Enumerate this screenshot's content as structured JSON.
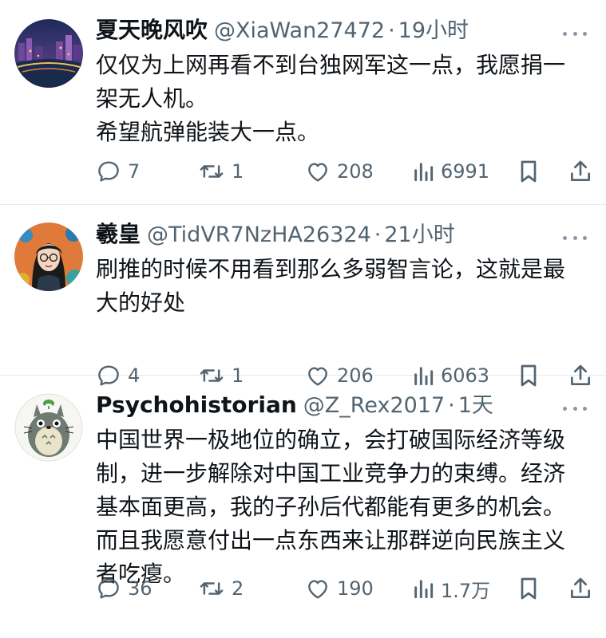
{
  "tweets": [
    {
      "display_name": "夏天晚风吹",
      "handle": "@XiaWan27472",
      "separator": "·",
      "time": "19小时",
      "lines": [
        "仅仅为上网再看不到台独网军这一点，我愿捐一",
        "架无人机。",
        "希望航弹能装大一点。"
      ],
      "replies": "7",
      "retweets": "1",
      "likes": "208",
      "views": "6991"
    },
    {
      "display_name": "羲皇",
      "handle": "@TidVR7NzHA26324",
      "separator": "·",
      "time": "21小时",
      "lines": [
        "刷推的时候不用看到那么多弱智言论，这就是最",
        "大的好处"
      ],
      "replies": "4",
      "retweets": "1",
      "likes": "206",
      "views": "6063"
    },
    {
      "display_name": "Psychohistorian",
      "handle": "@Z_Rex2017",
      "separator": "·",
      "time": "1天",
      "lines": [
        "中国世界一极地位的确立，会打破国际经济等级",
        "制，进一步解除对中国工业竞争力的束缚。经济",
        "基本面更高，我的子孙后代都能有更多的机会。",
        "而且我愿意付出一点东西来让那群逆向民族主义",
        "者吃瘪。"
      ],
      "replies": "36",
      "retweets": "2",
      "likes": "190",
      "views": "1.7万"
    }
  ],
  "colors": {
    "text": "#0f1419",
    "secondary": "#536471",
    "divider": "#e6e9ec"
  }
}
